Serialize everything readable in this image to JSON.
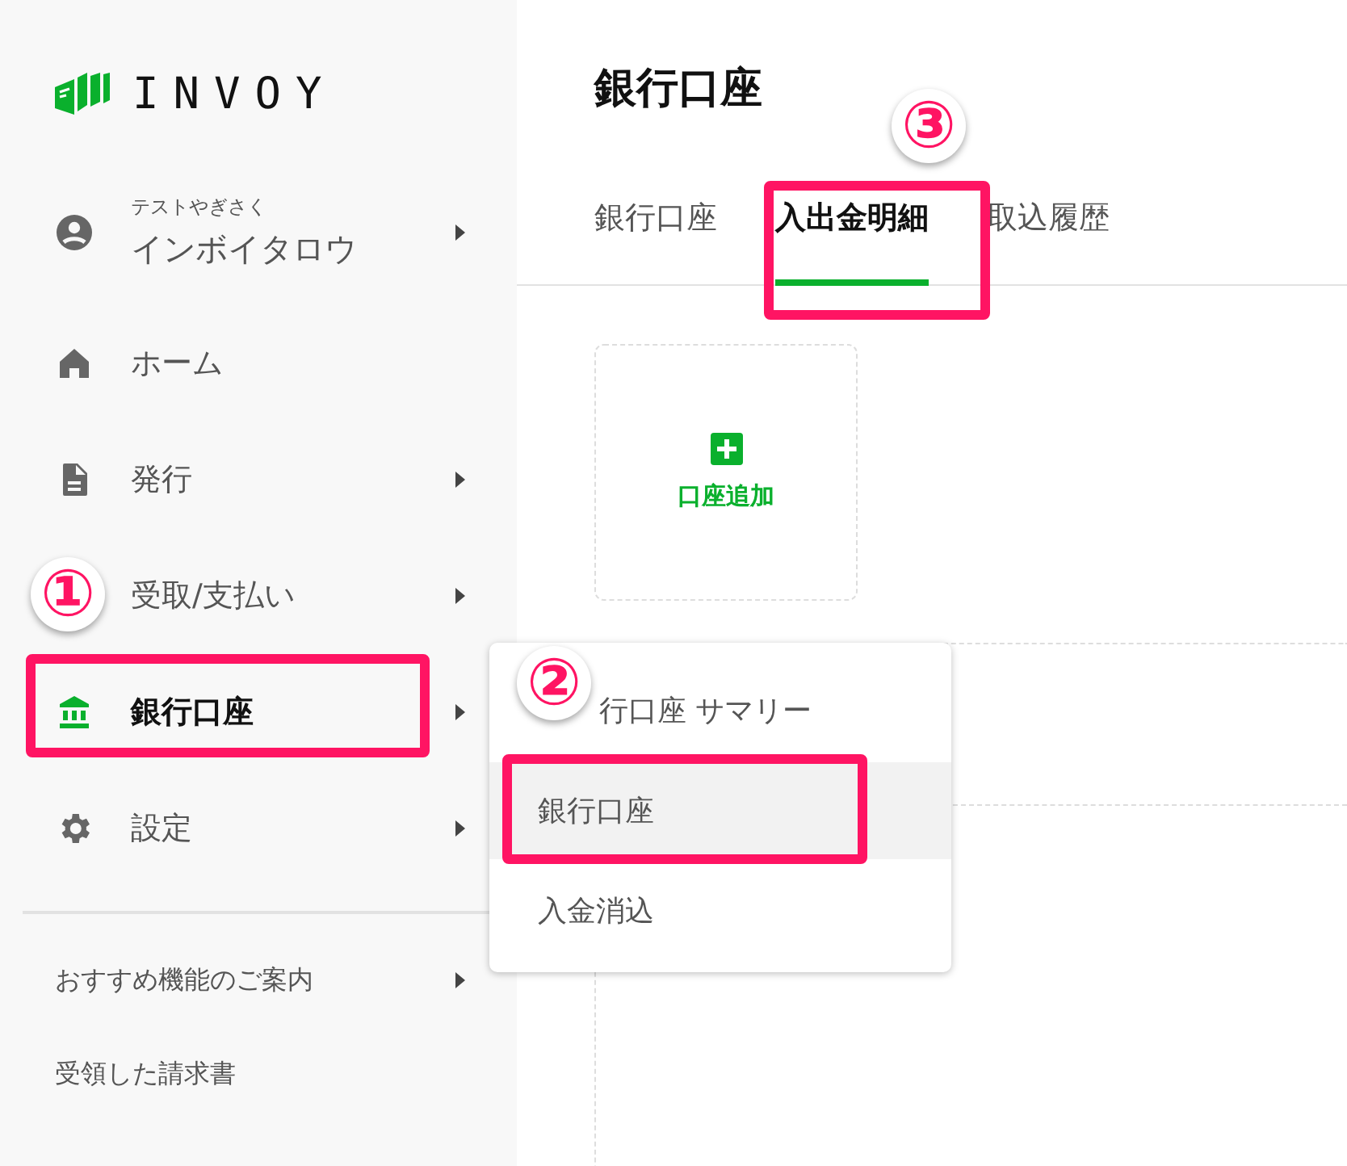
{
  "sidebar": {
    "logo": "INVOY",
    "user": {
      "company": "テストやぎさく",
      "name": "インボイタロウ",
      "has_submenu": true
    },
    "items": [
      {
        "label": "ホーム",
        "selected": false,
        "has_submenu": false
      },
      {
        "label": "発行",
        "selected": false,
        "has_submenu": true
      },
      {
        "label": "受取/支払い",
        "selected": false,
        "has_submenu": true
      },
      {
        "label": "銀行口座",
        "selected": true,
        "has_submenu": true
      },
      {
        "label": "設定",
        "selected": false,
        "has_submenu": true
      }
    ],
    "links": [
      {
        "label": "おすすめ機能のご案内",
        "has_submenu": true
      },
      {
        "label": "受領した請求書",
        "has_submenu": false
      }
    ]
  },
  "page": {
    "title": "銀行口座",
    "tabs": [
      {
        "label": "銀行口座",
        "selected": false
      },
      {
        "label": "入出金明細",
        "selected": true
      },
      {
        "label": "取込履歴",
        "selected": false
      }
    ],
    "add_card": {
      "label": "口座追加"
    }
  },
  "submenu": {
    "items": [
      {
        "label": "行口座 サマリー",
        "highlighted": false
      },
      {
        "label": "銀行口座",
        "highlighted": true
      },
      {
        "label": "入金消込",
        "highlighted": false
      }
    ]
  },
  "annotations": [
    {
      "number": "①"
    },
    {
      "number": "②"
    },
    {
      "number": "③"
    }
  ]
}
